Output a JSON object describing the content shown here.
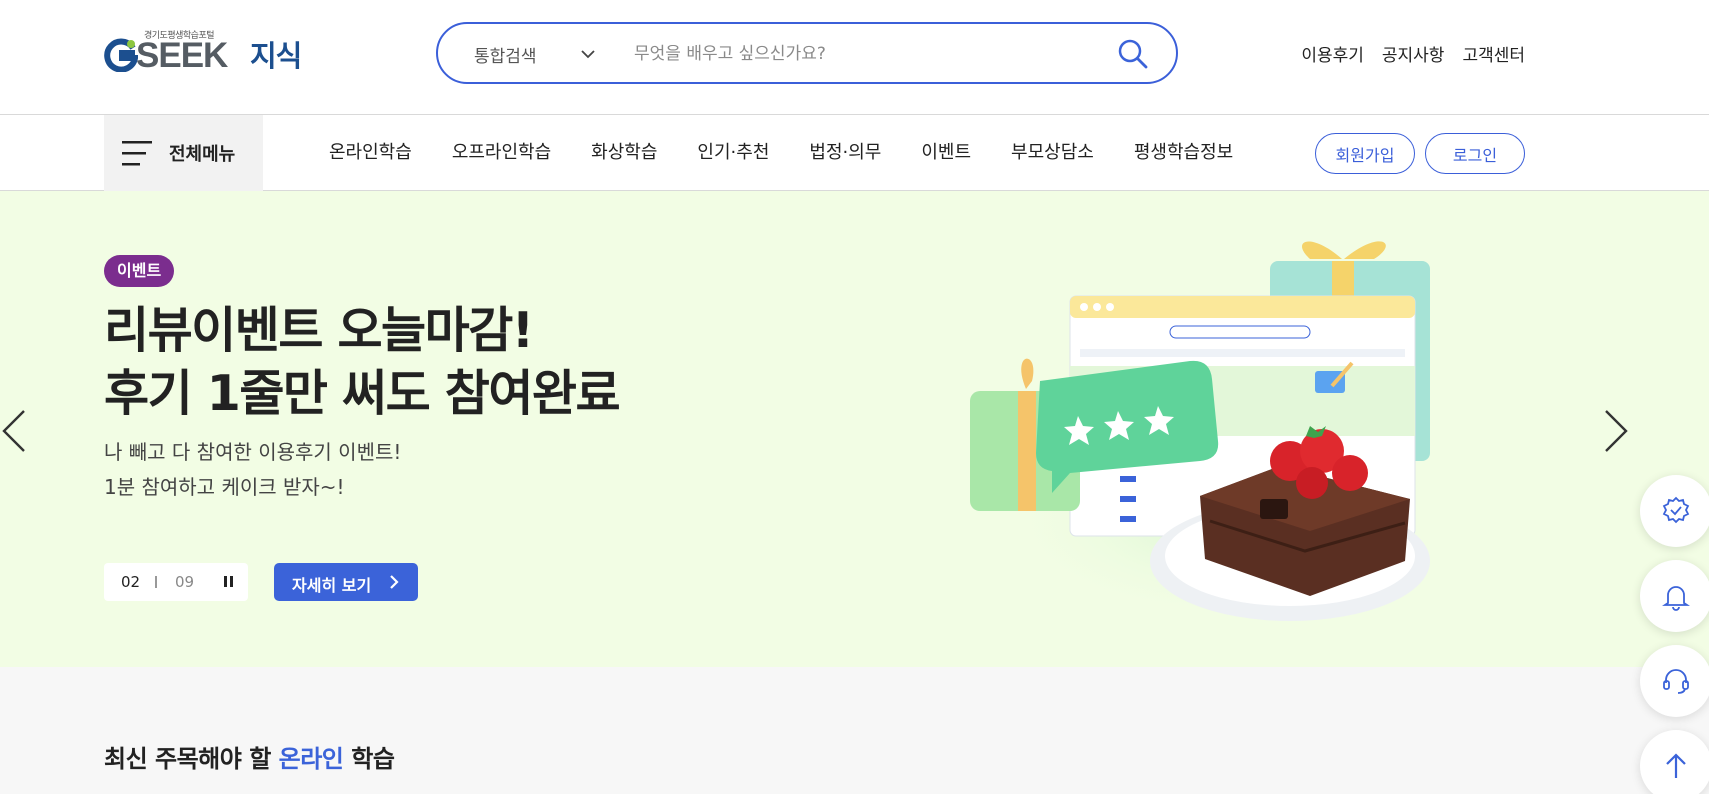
{
  "header": {
    "logo": {
      "tagline": "경기도평생학습포털",
      "wordmark": "SEEK",
      "name": "지식"
    },
    "search": {
      "category": "통합검색",
      "placeholder": "무엇을 배우고 싶으신가요?",
      "value": ""
    },
    "util_links": [
      "이용후기",
      "공지사항",
      "고객센터"
    ]
  },
  "gnb": {
    "all_menu_label": "전체메뉴",
    "items": [
      "온라인학습",
      "오프라인학습",
      "화상학습",
      "인기·추천",
      "법정·의무",
      "이벤트",
      "부모상담소",
      "평생학습정보"
    ],
    "signup_label": "회원가입",
    "login_label": "로그인"
  },
  "hero": {
    "badge": "이벤트",
    "title_line1": "리뷰이벤트 오늘마감!",
    "title_line2": "후기 1줄만 써도 참여완료",
    "subtitle_line1": "나 빼고 다 참여한 이용후기 이벤트!",
    "subtitle_line2": "1분 참여하고 케이크 받자~!",
    "pager_current": "02",
    "pager_total": "09",
    "more_label": "자세히 보기"
  },
  "section": {
    "title_before": "최신 주목해야 할 ",
    "title_highlight": "온라인",
    "title_after": " 학습"
  },
  "quick_menu": [
    "badge-icon",
    "bell-icon",
    "headset-icon",
    "arrow-up-icon"
  ],
  "colors": {
    "accent": "#3b63d9",
    "hero_bg": "#f2fde4",
    "badge_bg": "#7b2d8e",
    "logo_navy": "#1c4f8f"
  }
}
